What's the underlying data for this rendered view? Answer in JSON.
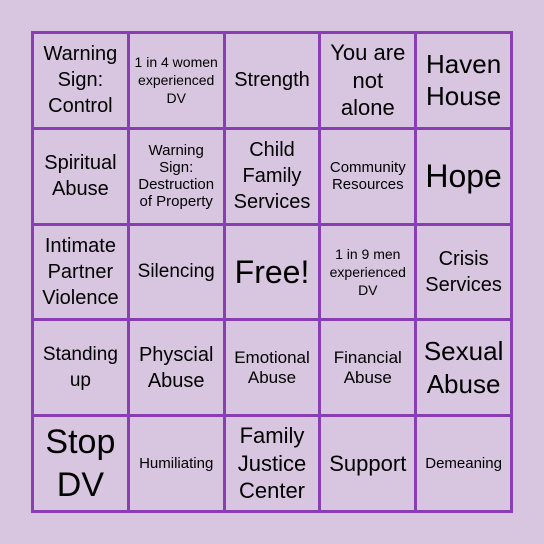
{
  "colors": {
    "background": "#d8c6e0",
    "grid_lines": "#8a3db4",
    "text": "#000000"
  },
  "board": {
    "cells": [
      "Warning Sign: Control",
      "1 in 4 women experienced DV",
      "Strength",
      "You are not alone",
      "Haven House",
      "Spiritual Abuse",
      "Warning Sign: Destruction of Property",
      "Child Family Services",
      "Community Resources",
      "Hope",
      "Intimate Partner Violence",
      "Silencing",
      "Free!",
      "1 in 9 men experienced DV",
      "Crisis Services",
      "Standing up",
      "Physcial Abuse",
      "Emotional Abuse",
      "Financial Abuse",
      "Sexual Abuse",
      "Stop DV",
      "Humiliating",
      "Family Justice Center",
      "Support",
      "Demeaning"
    ]
  }
}
